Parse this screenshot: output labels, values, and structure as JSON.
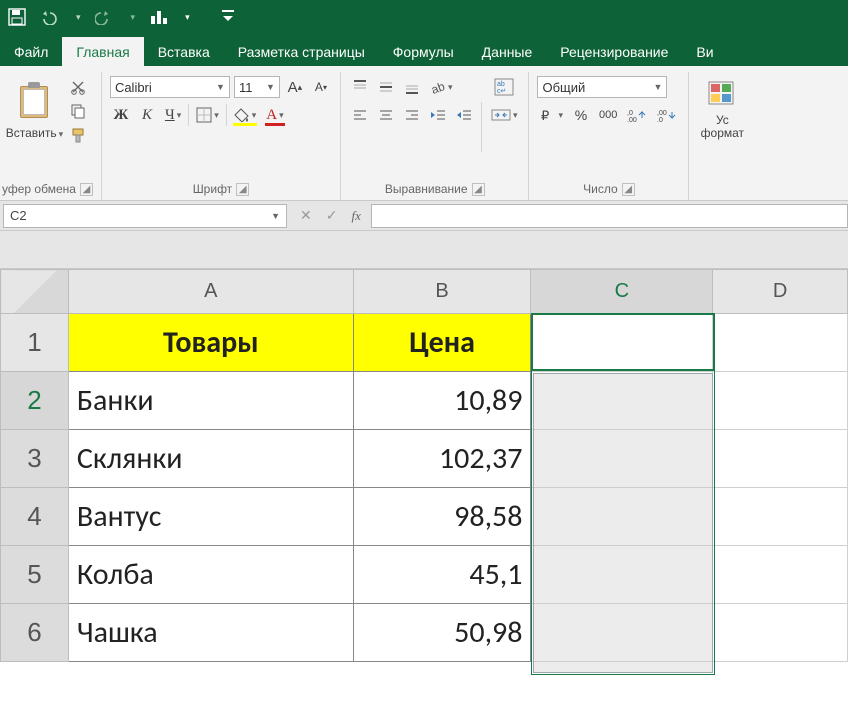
{
  "ribbon": {
    "tabs": {
      "file": "Файл",
      "home": "Главная",
      "insert": "Вставка",
      "pagelayout": "Разметка страницы",
      "formulas": "Формулы",
      "data": "Данные",
      "review": "Рецензирование",
      "view_partial": "Ви"
    },
    "clipboard": {
      "paste": "Вставить",
      "group": "уфер обмена"
    },
    "font": {
      "name": "Calibri",
      "size": "11",
      "bold": "Ж",
      "italic": "К",
      "underline": "Ч",
      "group": "Шрифт"
    },
    "alignment": {
      "group": "Выравнивание"
    },
    "number": {
      "format": "Общий",
      "percent": "%",
      "thousands": "000",
      "group": "Число"
    },
    "cellstyles": {
      "cond_l1": "Ус",
      "cond_l2": "формат"
    }
  },
  "formula_bar": {
    "name_box": "C2",
    "fx": "fx"
  },
  "sheet": {
    "col_headers": [
      "A",
      "B",
      "C",
      "D"
    ],
    "row_headers": [
      "1",
      "2",
      "3",
      "4",
      "5",
      "6"
    ],
    "header_row": {
      "A": "Товары",
      "B": "Цена"
    },
    "rows": [
      {
        "A": "Банки",
        "B": "10,89"
      },
      {
        "A": "Склянки",
        "B": "102,37"
      },
      {
        "A": "Вантус",
        "B": "98,58"
      },
      {
        "A": "Колба",
        "B": "45,1"
      },
      {
        "A": "Чашка",
        "B": "50,98"
      }
    ]
  },
  "chart_data": {
    "type": "table",
    "columns": [
      "Товары",
      "Цена"
    ],
    "rows": [
      [
        "Банки",
        10.89
      ],
      [
        "Склянки",
        102.37
      ],
      [
        "Вантус",
        98.58
      ],
      [
        "Колба",
        45.1
      ],
      [
        "Чашка",
        50.98
      ]
    ]
  }
}
